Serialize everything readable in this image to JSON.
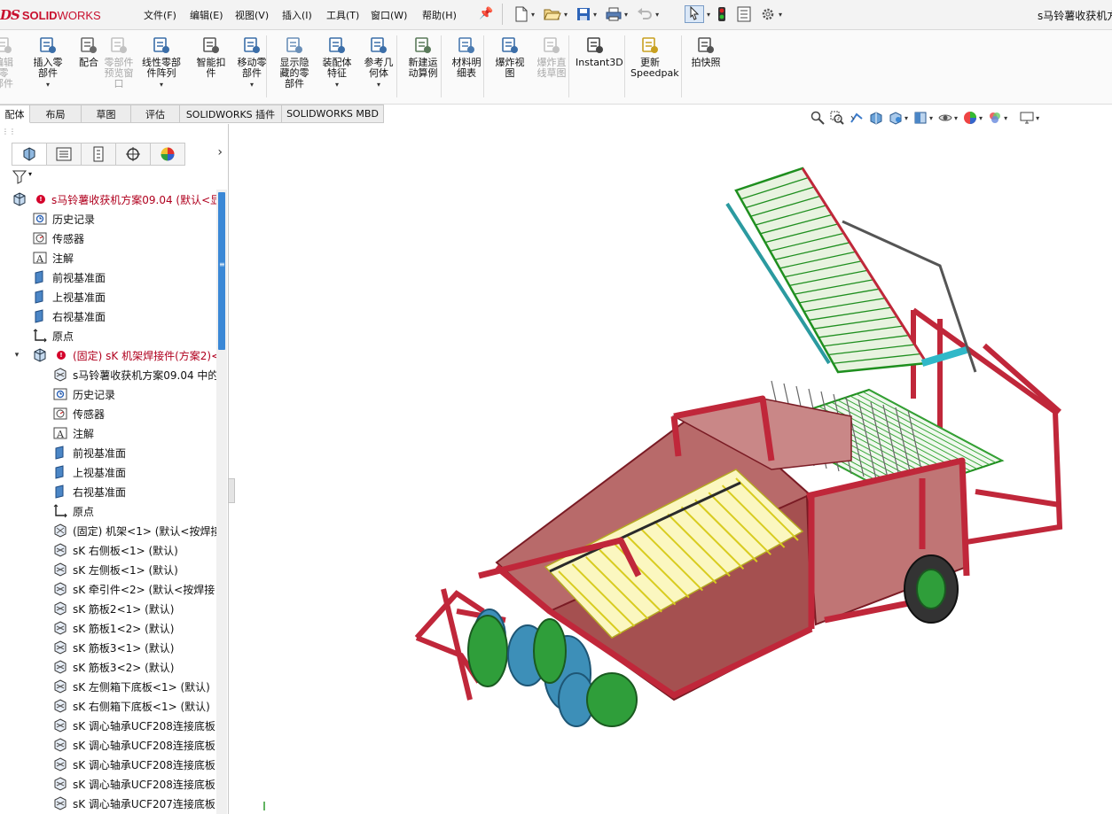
{
  "app": {
    "logo_ds": "DS",
    "logo_solid": "SOLID",
    "logo_works": "WORKS",
    "document_title": "s马铃薯收获机方"
  },
  "menu": [
    "文件(F)",
    "编辑(E)",
    "视图(V)",
    "插入(I)",
    "工具(T)",
    "窗口(W)",
    "帮助(H)"
  ],
  "commands": [
    {
      "label": "编辑零\n部件",
      "disabled": true,
      "icon": "edit-component-icon"
    },
    {
      "label": "插入零\n部件",
      "disabled": false,
      "icon": "insert-component-icon",
      "dropdown": true
    },
    {
      "label": "配合",
      "disabled": false,
      "icon": "mate-icon"
    },
    {
      "label": "零部件\n预览窗\n口",
      "disabled": true,
      "icon": "component-preview-icon"
    },
    {
      "label": "线性零部\n件阵列",
      "disabled": false,
      "icon": "linear-pattern-icon",
      "dropdown": true
    },
    {
      "label": "智能扣\n件",
      "disabled": false,
      "icon": "smart-fasteners-icon"
    },
    {
      "label": "移动零\n部件",
      "disabled": false,
      "icon": "move-component-icon",
      "dropdown": true
    },
    {
      "label": "显示隐\n藏的零\n部件",
      "disabled": false,
      "icon": "show-hidden-icon"
    },
    {
      "label": "装配体\n特征",
      "disabled": false,
      "icon": "assembly-features-icon",
      "dropdown": true
    },
    {
      "label": "参考几\n何体",
      "disabled": false,
      "icon": "reference-geometry-icon",
      "dropdown": true
    },
    {
      "label": "新建运\n动算例",
      "disabled": false,
      "icon": "new-motion-study-icon"
    },
    {
      "label": "材料明\n细表",
      "disabled": false,
      "icon": "bill-of-materials-icon"
    },
    {
      "label": "爆炸视\n图",
      "disabled": false,
      "icon": "exploded-view-icon"
    },
    {
      "label": "爆炸直\n线草图",
      "disabled": true,
      "icon": "explode-line-sketch-icon"
    },
    {
      "label": "Instant3D",
      "disabled": false,
      "icon": "instant3d-icon"
    },
    {
      "label": "更新\nSpeedpak",
      "disabled": false,
      "icon": "update-speedpak-icon"
    },
    {
      "label": "拍快照",
      "disabled": false,
      "icon": "snapshot-icon"
    }
  ],
  "tabs": [
    "配体",
    "布局",
    "草图",
    "评估",
    "SOLIDWORKS 插件",
    "SOLIDWORKS MBD"
  ],
  "tree": {
    "root": "s马铃薯收获机方案09.04  (默认<显",
    "items": [
      {
        "label": "历史记录",
        "icon": "history-icon"
      },
      {
        "label": "传感器",
        "icon": "sensor-icon"
      },
      {
        "label": "注解",
        "icon": "annotation-icon",
        "expand": true
      },
      {
        "label": "前视基准面",
        "icon": "plane-icon"
      },
      {
        "label": "上视基准面",
        "icon": "plane-icon"
      },
      {
        "label": "右视基准面",
        "icon": "plane-icon"
      },
      {
        "label": "原点",
        "icon": "origin-icon"
      }
    ],
    "subassembly": "(固定) sK 机架焊接件(方案2)<",
    "sub_items": [
      {
        "label": "s马铃薯收获机方案09.04 中的",
        "icon": "part-icon",
        "expand": true
      },
      {
        "label": "历史记录",
        "icon": "history-icon"
      },
      {
        "label": "传感器",
        "icon": "sensor-icon"
      },
      {
        "label": "注解",
        "icon": "annotation-icon",
        "expand": true
      },
      {
        "label": "前视基准面",
        "icon": "plane-icon"
      },
      {
        "label": "上视基准面",
        "icon": "plane-icon"
      },
      {
        "label": "右视基准面",
        "icon": "plane-icon"
      },
      {
        "label": "原点",
        "icon": "origin-icon"
      },
      {
        "label": "(固定) 机架<1> (默认<按焊接",
        "icon": "weldment-icon",
        "expand": true
      },
      {
        "label": "sK 右侧板<1> (默认)",
        "icon": "part-icon",
        "expand": true
      },
      {
        "label": "sK 左侧板<1> (默认)",
        "icon": "part-icon",
        "expand": true
      },
      {
        "label": "sK 牵引件<2> (默认<按焊接",
        "icon": "part-icon",
        "expand": true
      },
      {
        "label": "sK 筋板2<1> (默认)",
        "icon": "part-icon",
        "expand": true
      },
      {
        "label": "sK 筋板1<2> (默认)",
        "icon": "part-icon",
        "expand": true
      },
      {
        "label": "sK 筋板3<1> (默认)",
        "icon": "part-icon",
        "expand": true
      },
      {
        "label": "sK 筋板3<2> (默认)",
        "icon": "part-icon",
        "expand": true
      },
      {
        "label": "sK 左侧箱下底板<1> (默认)",
        "icon": "part-icon",
        "expand": true
      },
      {
        "label": "sK 右侧箱下底板<1> (默认)",
        "icon": "part-icon",
        "expand": true
      },
      {
        "label": "sK 调心轴承UCF208连接底板",
        "icon": "part-icon",
        "expand": true
      },
      {
        "label": "sK 调心轴承UCF208连接底板",
        "icon": "part-icon",
        "expand": true
      },
      {
        "label": "sK 调心轴承UCF208连接底板",
        "icon": "part-icon",
        "expand": true
      },
      {
        "label": "sK 调心轴承UCF208连接底板",
        "icon": "part-icon",
        "expand": true
      },
      {
        "label": "sK 调心轴承UCF207连接底板",
        "icon": "part-icon",
        "expand": true
      }
    ]
  },
  "colors": {
    "frame_red": "#c0273a",
    "frame_dark": "#7a1b24",
    "conveyor_green": "#1f8f1f",
    "mesh_yellow": "#e3dc3a",
    "disc_blue": "#3d8fb8",
    "disc_green": "#2f9e3a",
    "accent_blue": "#3b88d6",
    "error_red": "#d4002a"
  }
}
